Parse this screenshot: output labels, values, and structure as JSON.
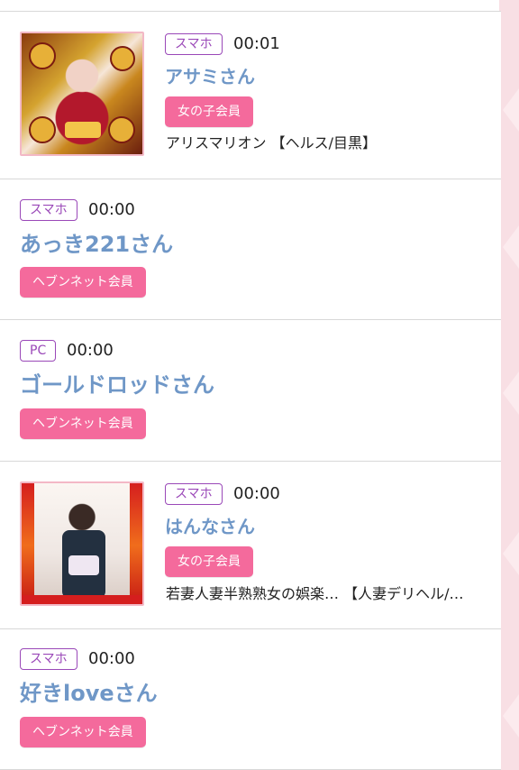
{
  "items": [
    {
      "device": "スマホ",
      "time": "00:01",
      "name": "アサミさん",
      "member": "女の子会員",
      "shop": "アリスマリオン 【ヘルス/目黒】"
    },
    {
      "device": "スマホ",
      "time": "00:00",
      "name": "あっき221さん",
      "member": "ヘブンネット会員"
    },
    {
      "device": "PC",
      "time": "00:00",
      "name": "ゴールドロッドさん",
      "member": "ヘブンネット会員"
    },
    {
      "device": "スマホ",
      "time": "00:00",
      "name": "はんなさん",
      "member": "女の子会員",
      "shop": "若妻人妻半熟熟女の娯楽… 【人妻デリヘル/…"
    },
    {
      "device": "スマホ",
      "time": "00:00",
      "name": "好きloveさん",
      "member": "ヘブンネット会員"
    }
  ],
  "colors": {
    "name": "#6f97c7",
    "badge": "#9a48b8",
    "button": "#f46a9c",
    "strip": "#f8dfe4"
  }
}
